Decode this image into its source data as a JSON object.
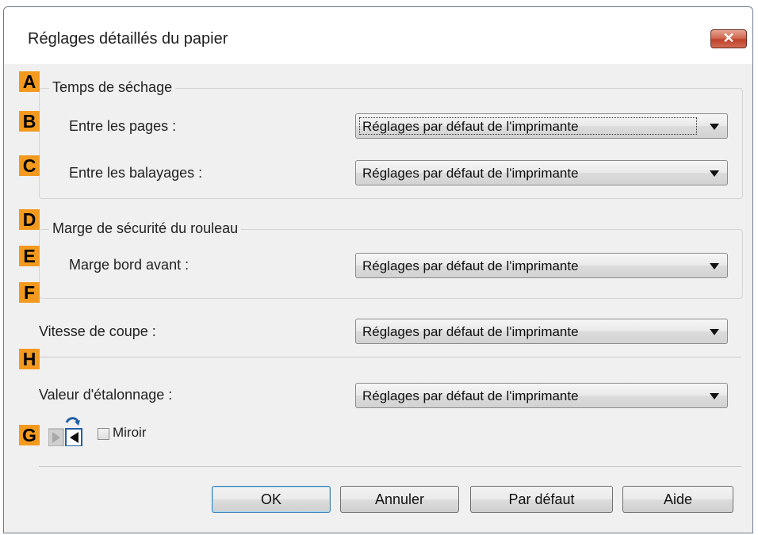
{
  "window": {
    "title": "Réglages détaillés du papier",
    "close_label": "✕"
  },
  "badges": {
    "a": "A",
    "b": "B",
    "c": "C",
    "d": "D",
    "e": "E",
    "f": "F",
    "h": "H",
    "g": "G"
  },
  "drying": {
    "legend": "Temps de séchage",
    "between_pages_label": "Entre les pages :",
    "between_pages_value": "Réglages par défaut de l'imprimante",
    "between_scans_label": "Entre les balayages :",
    "between_scans_value": "Réglages par défaut de l'imprimante"
  },
  "roll_margin": {
    "legend": "Marge de sécurité du rouleau",
    "leading_edge_label": "Marge bord avant :",
    "leading_edge_value": "Réglages par défaut de l'imprimante"
  },
  "cut_speed": {
    "label": "Vitesse de coupe :",
    "value": "Réglages par défaut de l'imprimante"
  },
  "calibration": {
    "label": "Valeur d'étalonnage :",
    "value": "Réglages par défaut de l'imprimante"
  },
  "mirror": {
    "label": "Miroir",
    "checked": false
  },
  "buttons": {
    "ok": "OK",
    "cancel": "Annuler",
    "default": "Par défaut",
    "help": "Aide"
  },
  "colors": {
    "badge": "#f39a1e",
    "close": "#c0402a",
    "mirror_icon": "#1f5fa8"
  }
}
